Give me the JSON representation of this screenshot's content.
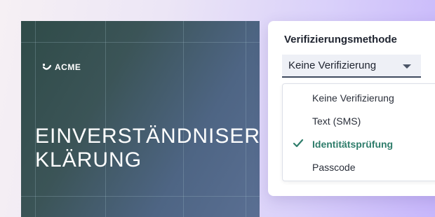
{
  "document": {
    "logo_text": "ACME",
    "title_line1": "EINVERSTÄNDNISER-",
    "title_line2": "KLÄRUNG"
  },
  "verification": {
    "label": "Verifizierungsmethode",
    "selected_value": "Keine Verifizierung",
    "options": [
      {
        "label": "Keine Verifizierung"
      },
      {
        "label": "Text (SMS)"
      },
      {
        "label": "Identitätsprüfung",
        "checked": true
      },
      {
        "label": "Passcode"
      }
    ]
  },
  "colors": {
    "accent": "#2f7d6b",
    "doc_background_start": "#2f4b48",
    "doc_background_end": "#5a6f93"
  },
  "icons": [
    "acme-logo-icon",
    "dropdown-caret-icon",
    "checkmark-icon"
  ]
}
